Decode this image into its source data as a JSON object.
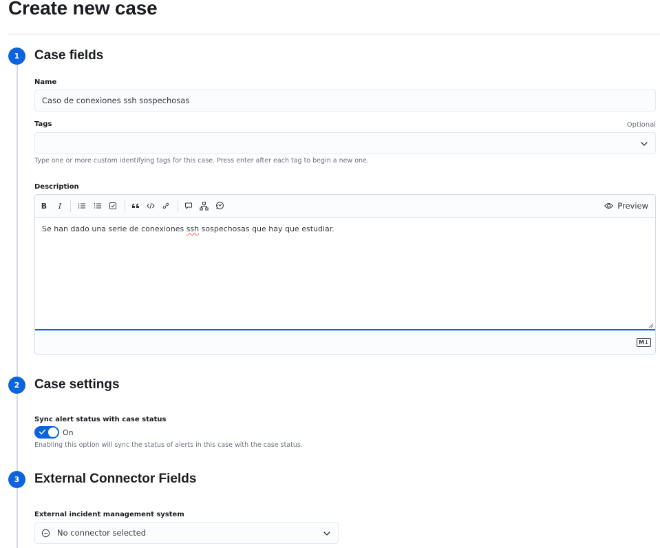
{
  "page": {
    "title": "Create new case"
  },
  "steps": [
    {
      "number": "1",
      "title": "Case fields"
    },
    {
      "number": "2",
      "title": "Case settings"
    },
    {
      "number": "3",
      "title": "External Connector Fields"
    }
  ],
  "case_fields": {
    "name": {
      "label": "Name",
      "value": "Caso de conexiones ssh sospechosas"
    },
    "tags": {
      "label": "Tags",
      "optional_label": "Optional",
      "value": "",
      "help": "Type one or more custom identifying tags for this case. Press enter after each tag to begin a new one."
    },
    "description": {
      "label": "Description",
      "toolbar": {
        "bold": "B",
        "italic": "I",
        "preview_label": "Preview",
        "icons": [
          "bold-icon",
          "italic-icon",
          "bullet-list-icon",
          "numbered-list-icon",
          "task-list-icon",
          "quote-icon",
          "code-icon",
          "link-icon",
          "comment-icon",
          "diagram-icon",
          "timeline-icon",
          "eye-icon"
        ]
      },
      "text_before": "Se han dado una serie de conexiones ",
      "text_misspelled": "ssh",
      "text_after": " sospechosas que hay que estudiar.",
      "markdown_badge": "M↓"
    }
  },
  "case_settings": {
    "sync": {
      "label": "Sync alert status with case status",
      "enabled": true,
      "state_label": "On",
      "help": "Enabling this option will sync the status of alerts in this case with the case status."
    }
  },
  "connector": {
    "label": "External incident management system",
    "selected": "No connector selected"
  },
  "colors": {
    "accent": "#0b64dd",
    "border": "#d3dae6",
    "text": "#1a1c21",
    "subdued": "#69707d"
  }
}
